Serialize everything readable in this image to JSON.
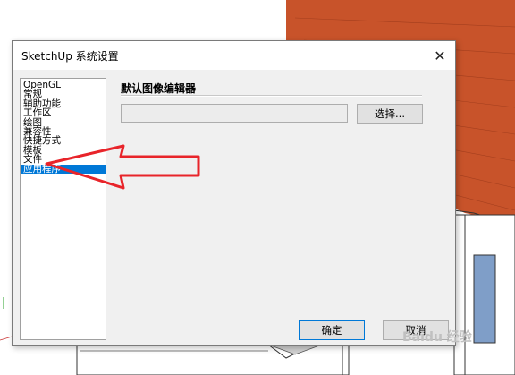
{
  "dialog": {
    "title": "SketchUp 系统设置",
    "close_icon": "close-icon"
  },
  "sidebar": {
    "items": [
      {
        "label": "OpenGL"
      },
      {
        "label": "常规"
      },
      {
        "label": "辅助功能"
      },
      {
        "label": "工作区"
      },
      {
        "label": "绘图"
      },
      {
        "label": "兼容性"
      },
      {
        "label": "快捷方式"
      },
      {
        "label": "模板"
      },
      {
        "label": "文件"
      },
      {
        "label": "应用程序",
        "selected": true
      }
    ]
  },
  "main": {
    "section_title": "默认图像编辑器",
    "path_value": "",
    "choose_label": "选择..."
  },
  "footer": {
    "ok_label": "确定",
    "cancel_label": "取消"
  },
  "annotation": {
    "arrow_color": "#e8242a",
    "points_to": "模板"
  },
  "colors": {
    "selection": "#0078d7",
    "roof": "#c8532a",
    "wall": "#ffffff",
    "window": "#7f9ec8"
  }
}
